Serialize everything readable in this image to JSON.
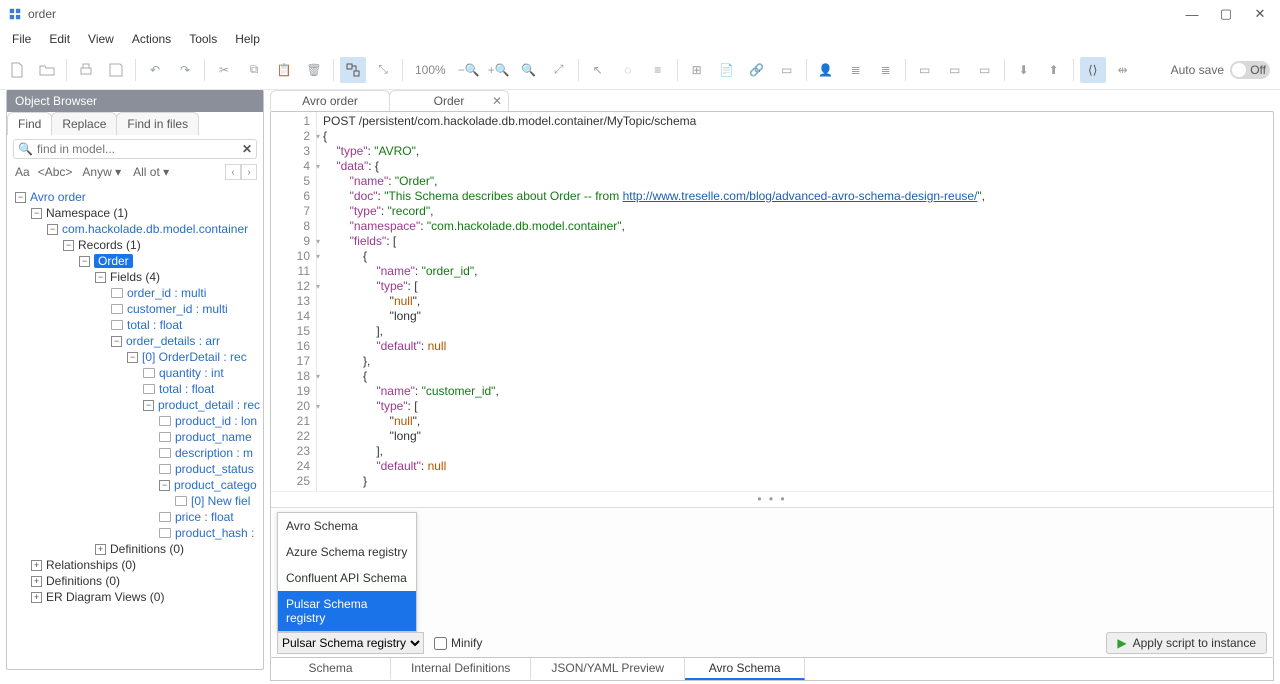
{
  "window": {
    "title": "order"
  },
  "menu": [
    "File",
    "Edit",
    "View",
    "Actions",
    "Tools",
    "Help"
  ],
  "toolbar": {
    "zoom": "100%",
    "autosave_label": "Auto save",
    "autosave_state": "Off"
  },
  "object_browser": {
    "title": "Object Browser",
    "tabs": [
      "Find",
      "Replace",
      "Find in files"
    ],
    "search_placeholder": "find in model...",
    "filters": {
      "case": "Aa",
      "whole": "<Abc>",
      "where": "Anyw",
      "what": "All ot"
    },
    "tree": {
      "root": "Avro order",
      "namespace": "Namespace (1)",
      "container": "com.hackolade.db.model.container",
      "records": "Records (1)",
      "order": "Order",
      "fields": "Fields (4)",
      "items": [
        "order_id : multi",
        "customer_id : multi",
        "total : float",
        "order_details : arr",
        "[0] OrderDetail : rec",
        "quantity : int",
        "total : float",
        "product_detail : rec",
        "product_id : lon",
        "product_name",
        "description : m",
        "product_status",
        "product_catego",
        "[0] New fiel",
        "price : float",
        "product_hash :"
      ],
      "definitions": "Definitions (0)",
      "relationships": "Relationships (0)",
      "defs2": "Definitions (0)",
      "er": "ER Diagram Views (0)"
    }
  },
  "tabs": [
    {
      "label": "Avro order",
      "closable": false
    },
    {
      "label": "Order",
      "closable": true
    }
  ],
  "code": {
    "url_text": "http://www.treselle.com/blog/advanced-avro-schema-design-reuse/",
    "lines": [
      "POST /persistent/com.hackolade.db.model.container/MyTopic/schema",
      "{",
      "    \"type\": \"AVRO\",",
      "    \"data\": {",
      "        \"name\": \"Order\",",
      "        \"doc\": \"This Schema describes about Order -- from http://www.treselle.com/blog/advanced-avro-schema-design-reuse/\",",
      "        \"type\": \"record\",",
      "        \"namespace\": \"com.hackolade.db.model.container\",",
      "        \"fields\": [",
      "            {",
      "                \"name\": \"order_id\",",
      "                \"type\": [",
      "                    \"null\",",
      "                    \"long\"",
      "                ],",
      "                \"default\": null",
      "            },",
      "            {",
      "                \"name\": \"customer_id\",",
      "                \"type\": [",
      "                    \"null\",",
      "                    \"long\"",
      "                ],",
      "                \"default\": null",
      "            }"
    ],
    "fold_lines": [
      2,
      4,
      9,
      10,
      12,
      18,
      20
    ]
  },
  "dropdown": {
    "options": [
      "Avro Schema",
      "Azure Schema registry",
      "Confluent API Schema",
      "Pulsar Schema registry"
    ],
    "selected": "Pulsar Schema registry"
  },
  "bottom": {
    "minify": "Minify",
    "apply": "Apply script to instance"
  },
  "bottom_tabs": [
    "Schema",
    "Internal Definitions",
    "JSON/YAML Preview",
    "Avro Schema"
  ]
}
